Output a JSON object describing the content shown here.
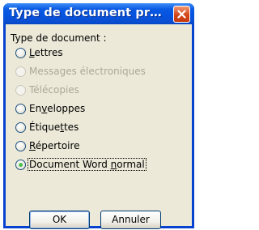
{
  "window": {
    "title": "Type de document pr…",
    "close_label": "Fermer"
  },
  "dialog": {
    "heading": "Type de document :",
    "options": [
      {
        "pre": "",
        "accel": "L",
        "post": "ettres",
        "enabled": true,
        "selected": false
      },
      {
        "pre": "Messages électroniques",
        "accel": "",
        "post": "",
        "enabled": false,
        "selected": false
      },
      {
        "pre": "Télécopies",
        "accel": "",
        "post": "",
        "enabled": false,
        "selected": false
      },
      {
        "pre": "En",
        "accel": "v",
        "post": "eloppes",
        "enabled": true,
        "selected": false
      },
      {
        "pre": "Étique",
        "accel": "t",
        "post": "tes",
        "enabled": true,
        "selected": false
      },
      {
        "pre": "",
        "accel": "R",
        "post": "épertoire",
        "enabled": true,
        "selected": false
      },
      {
        "pre": "Document Word ",
        "accel": "n",
        "post": "ormal",
        "enabled": true,
        "selected": true
      }
    ]
  },
  "buttons": {
    "ok": "OK",
    "cancel": "Annuler"
  }
}
